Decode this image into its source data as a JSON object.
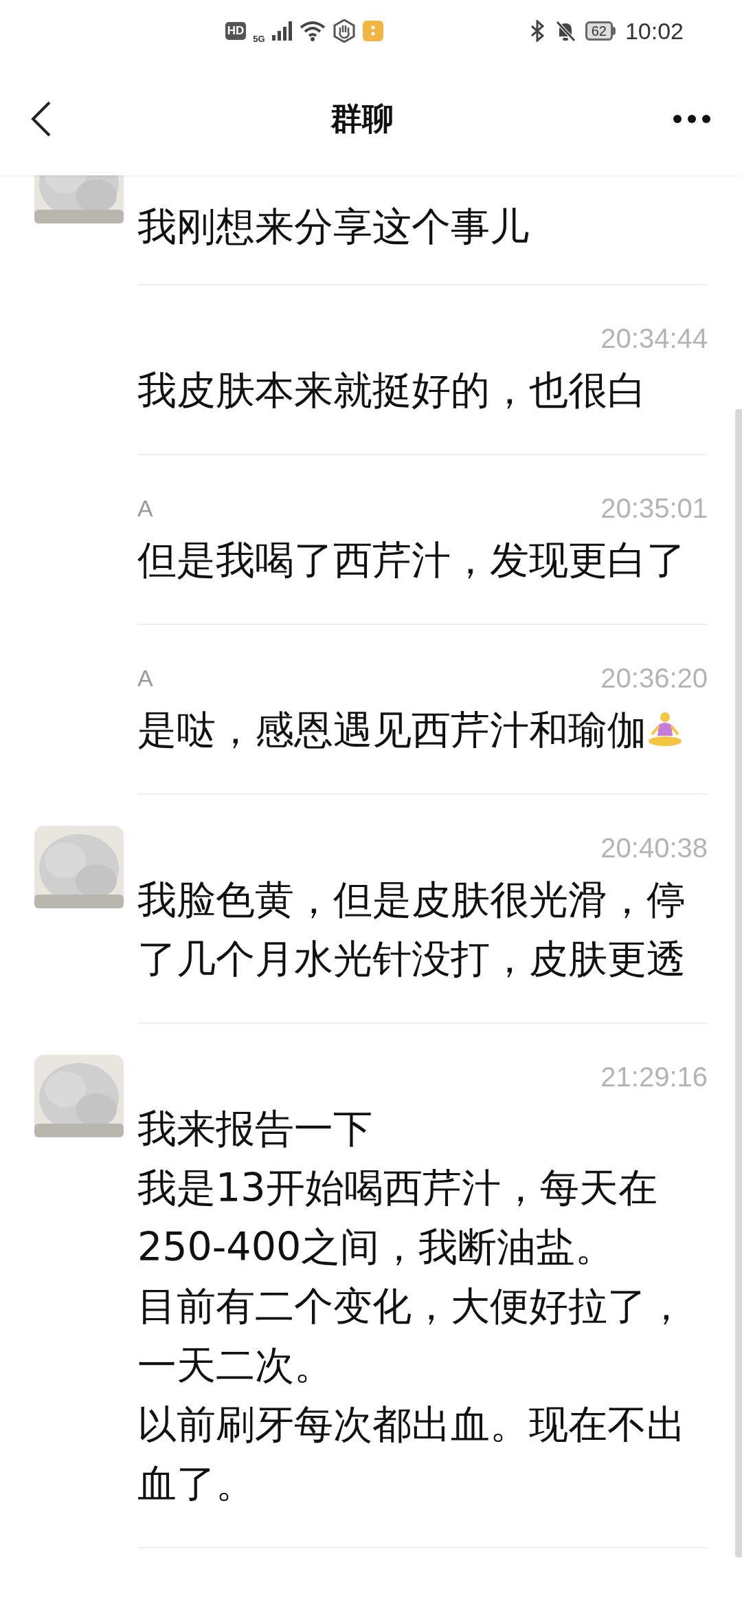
{
  "status_bar": {
    "hd": "HD",
    "network": "5G",
    "battery": "62",
    "time": "10:02"
  },
  "header": {
    "title": "群聊"
  },
  "messages": [
    {
      "avatar": true,
      "cut": true,
      "paragraphs": [
        "我刚想来分享这个事儿"
      ]
    },
    {
      "avatar": false,
      "cut": false,
      "time": "20:34:44",
      "paragraphs": [
        "我皮肤本来就挺好的，也很白"
      ]
    },
    {
      "avatar": false,
      "cut": false,
      "sender": "A",
      "time": "20:35:01",
      "paragraphs": [
        "但是我喝了西芹汁，发现更白了"
      ]
    },
    {
      "avatar": false,
      "cut": false,
      "sender": "A",
      "time": "20:36:20",
      "paragraphs": [
        "是哒，感恩遇见西芹汁和瑜伽"
      ],
      "yoga": true
    },
    {
      "avatar": true,
      "cut": false,
      "time": "20:40:38",
      "paragraphs": [
        "我脸色黄，但是皮肤很光滑，停了几个月水光针没打，皮肤更透"
      ]
    },
    {
      "avatar": true,
      "cut": false,
      "time": "21:29:16",
      "paragraphs": [
        "我来报告一下",
        "我是13开始喝西芹汁，每天在250-400之间，我断油盐。",
        "目前有二个变化，大便好拉了，一天二次。",
        "以前刷牙每次都出血。现在不出血了。"
      ]
    }
  ]
}
